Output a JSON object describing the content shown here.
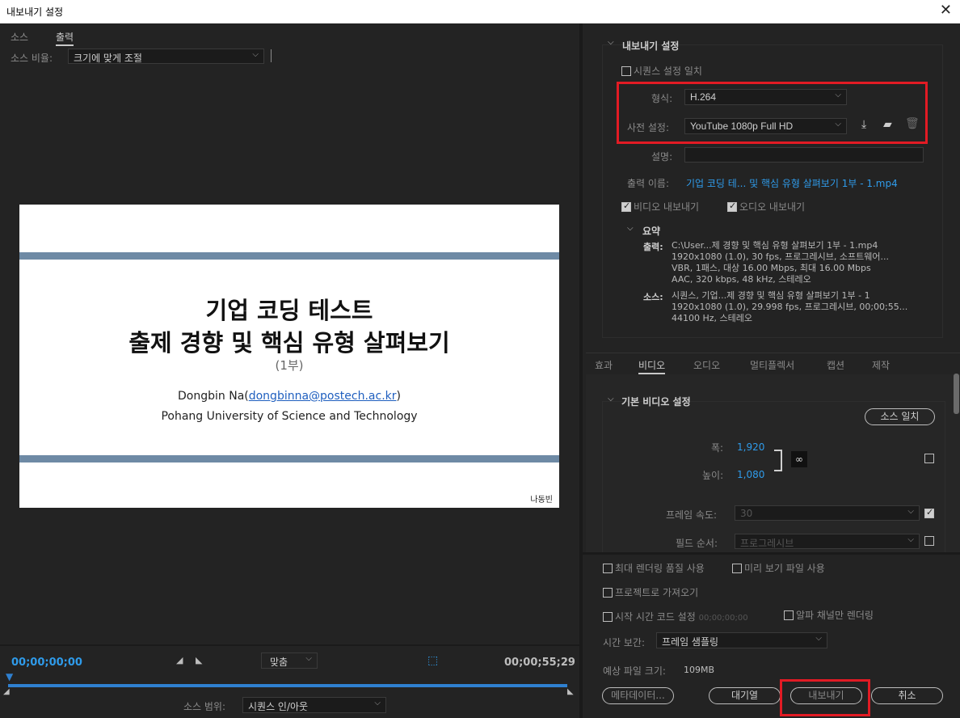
{
  "window": {
    "title": "내보내기 설정",
    "close_icon": "close-icon"
  },
  "left": {
    "tabs": [
      {
        "label": "소스"
      },
      {
        "label": "출력"
      }
    ],
    "source_scale_label": "소스 비율:",
    "source_scale_value": "크기에 맞게 조절",
    "slide": {
      "title1": "기업 코딩 테스트",
      "title2": "출제 경향 및 핵심 유형 살펴보기",
      "part": "(1부)",
      "author_prefix": "Dongbin Na(",
      "author_email": "dongbinna@postech.ac.kr",
      "author_suffix": ")",
      "affiliation": "Pohang University of Science and Technology",
      "signature": "나동빈"
    },
    "timeline": {
      "start_tc": "00;00;00;00",
      "end_tc": "00;00;55;29",
      "fit_value": "맞춤",
      "source_range_label": "소스 범위:",
      "source_range_value": "시퀀스 인/아웃"
    }
  },
  "export": {
    "section_title": "내보내기 설정",
    "match_sequence": "시퀀스 설정 일치",
    "format_label": "형식:",
    "format_value": "H.264",
    "preset_label": "사전 설정:",
    "preset_value": "YouTube 1080p Full HD",
    "comment_label": "설명:",
    "comment_value": "",
    "output_name_label": "출력 이름:",
    "output_name_value": "기업 코딩 테... 및 핵심 유형 살펴보기 1부 - 1.mp4",
    "export_video": "비디오 내보내기",
    "export_audio": "오디오 내보내기",
    "summary_title": "요약",
    "summary_output_label": "출력:",
    "summary_output_lines": [
      "C:\\User...제 경향 및 핵심 유형 살펴보기 1부 - 1.mp4",
      "1920x1080 (1.0), 30 fps, 프로그레시브, 소프트웨어...",
      "VBR, 1패스, 대상 16.00 Mbps, 최대 16.00 Mbps",
      "AAC, 320 kbps, 48 kHz, 스테레오"
    ],
    "summary_source_label": "소스:",
    "summary_source_lines": [
      "시퀀스, 기업...제 경향 및 핵심 유형 살펴보기 1부 - 1",
      "1920x1080 (1.0), 29.998 fps, 프로그레시브, 00;00;55...",
      "44100 Hz, 스테레오"
    ]
  },
  "tabs2": [
    {
      "label": "효과"
    },
    {
      "label": "비디오"
    },
    {
      "label": "오디오"
    },
    {
      "label": "멀티플렉서"
    },
    {
      "label": "캡션"
    },
    {
      "label": "제작"
    }
  ],
  "video": {
    "section_title": "기본 비디오 설정",
    "match_source": "소스 일치",
    "width_label": "폭:",
    "width_value": "1,920",
    "height_label": "높이:",
    "height_value": "1,080",
    "frame_rate_label": "프레임 속도:",
    "frame_rate_value": "30",
    "field_order_label": "필드 순서:",
    "field_order_value": "프로그레시브"
  },
  "bottom": {
    "max_render": "최대 렌더링 품질 사용",
    "use_previews": "미리 보기 파일 사용",
    "import_project": "프로젝트로 가져오기",
    "start_tc": "시작 시간 코드 설정",
    "start_tc_value": "00;00;00;00",
    "alpha_only": "알파 채널만 렌더링",
    "time_interp_label": "시간 보간:",
    "time_interp_value": "프레임 샘플링",
    "file_size_label": "예상 파일 크기:",
    "file_size_value": "109MB",
    "metadata_btn": "메타데이터...",
    "queue_btn": "대기열",
    "export_btn": "내보내기",
    "cancel_btn": "취소"
  },
  "colors": {
    "accent_blue": "#2f9bea",
    "highlight_red": "#e21b24",
    "slide_bar": "#6e8aa5"
  }
}
